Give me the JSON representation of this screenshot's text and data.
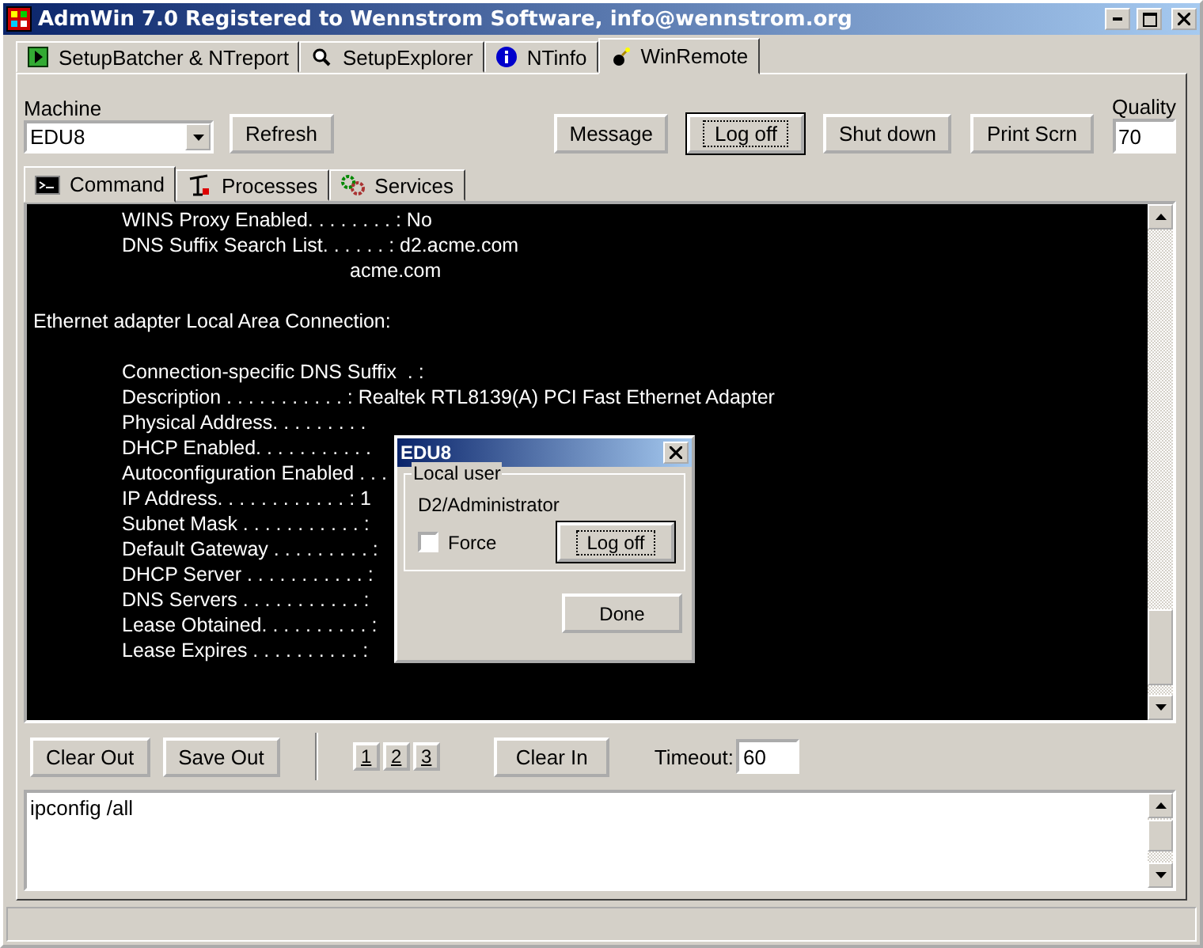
{
  "window": {
    "title": "AdmWin 7.0 Registered to Wennstrom Software, info@wennstrom.org"
  },
  "tabs": [
    {
      "label": "SetupBatcher & NTreport",
      "selected": false
    },
    {
      "label": "SetupExplorer",
      "selected": false
    },
    {
      "label": "NTinfo",
      "selected": false
    },
    {
      "label": "WinRemote",
      "selected": true
    }
  ],
  "machine": {
    "label": "Machine",
    "value": "EDU8"
  },
  "buttons": [
    {
      "label": "Refresh",
      "default": false
    },
    {
      "label": "Message",
      "default": false
    },
    {
      "label": "Log off",
      "default": true
    },
    {
      "label": "Shut down",
      "default": false
    },
    {
      "label": "Print Scrn",
      "default": false
    }
  ],
  "quality": {
    "label": "Quality",
    "value": "70"
  },
  "subtabs": [
    {
      "label": "Command",
      "selected": true
    },
    {
      "label": "Processes",
      "selected": false
    },
    {
      "label": "Services",
      "selected": false
    }
  ],
  "console": {
    "lines": [
      {
        "kind": "entry",
        "text": "WINS Proxy Enabled. . . . . . . . : No"
      },
      {
        "kind": "entry",
        "text": "DNS Suffix Search List. . . . . . : d2.acme.com"
      },
      {
        "kind": "continuation",
        "text": "acme.com"
      },
      {
        "kind": "blank"
      },
      {
        "kind": "heading",
        "text": "Ethernet adapter Local Area Connection:"
      },
      {
        "kind": "blank"
      },
      {
        "kind": "entry",
        "text": "Connection-specific DNS Suffix  . :"
      },
      {
        "kind": "entry",
        "text": "Description . . . . . . . . . . . : Realtek RTL8139(A) PCI Fast Ethernet Adapter"
      },
      {
        "kind": "entry",
        "text": "Physical Address. . . . . . . . ."
      },
      {
        "kind": "entry",
        "text": "DHCP Enabled. . . . . . . . . . ."
      },
      {
        "kind": "entry",
        "text": "Autoconfiguration Enabled . . ."
      },
      {
        "kind": "entry",
        "text": "IP Address. . . . . . . . . . . . : 1"
      },
      {
        "kind": "entry",
        "text": "Subnet Mask . . . . . . . . . . . :"
      },
      {
        "kind": "entry",
        "text": "Default Gateway . . . . . . . . . :"
      },
      {
        "kind": "entry",
        "text": "DHCP Server . . . . . . . . . . . :"
      },
      {
        "kind": "entry",
        "text": "DNS Servers . . . . . . . . . . . :"
      },
      {
        "kind": "entry",
        "text": "Lease Obtained. . . . . . . . . . :"
      },
      {
        "kind": "entry",
        "text": "Lease Expires . . . . . . . . . . :"
      }
    ]
  },
  "toolbar": {
    "buttons": [
      {
        "label": "Clear Out"
      },
      {
        "label": "Save Out"
      }
    ],
    "history": [
      {
        "label": "1"
      },
      {
        "label": "2"
      },
      {
        "label": "3"
      }
    ],
    "clear_in": {
      "label": "Clear In"
    },
    "timeout": {
      "label": "Timeout:",
      "value": "60"
    }
  },
  "command_input": {
    "value": "ipconfig /all"
  },
  "dialog": {
    "title": "EDU8",
    "group": "Local user",
    "user": "D2/Administrator",
    "force": {
      "label": "Force",
      "checked": false
    },
    "logoff": {
      "label": "Log off",
      "default": true
    },
    "done": {
      "label": "Done",
      "default": false
    }
  }
}
